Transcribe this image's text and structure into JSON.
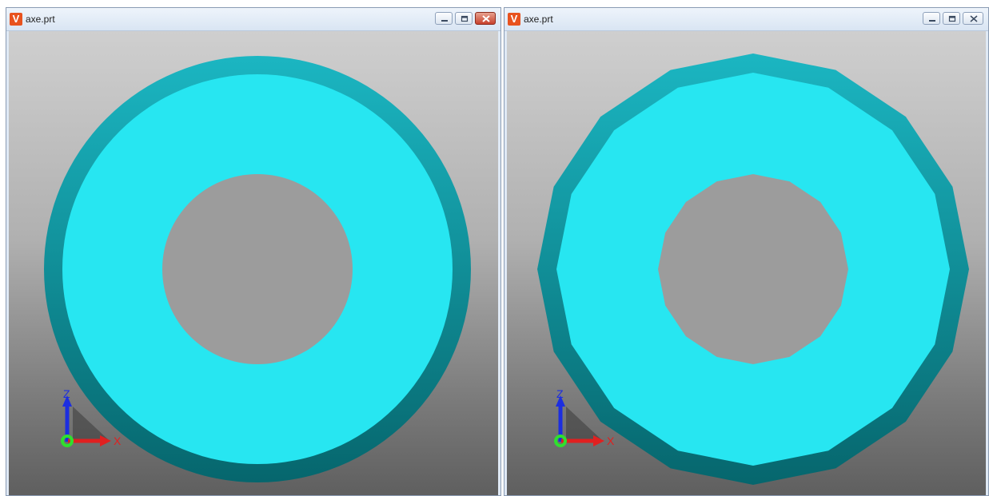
{
  "windows": [
    {
      "title": "axe.prt",
      "app_icon_letter": "V",
      "model": "smooth-ring",
      "axes": {
        "x_label": "X",
        "z_label": "Z"
      }
    },
    {
      "title": "axe.prt",
      "app_icon_letter": "V",
      "model": "faceted-ring-16-sides",
      "axes": {
        "x_label": "X",
        "z_label": "Z"
      }
    }
  ],
  "colors": {
    "ring_face": "#27e6f1",
    "ring_rim_top": "#1bb6c2",
    "ring_rim_bottom": "#06666d",
    "background_top": "#cfcfcf",
    "background_bottom": "#5f5f5f",
    "axis_x": "#e02020",
    "axis_z": "#1c2ee0",
    "axis_y": "#2ee02e"
  }
}
